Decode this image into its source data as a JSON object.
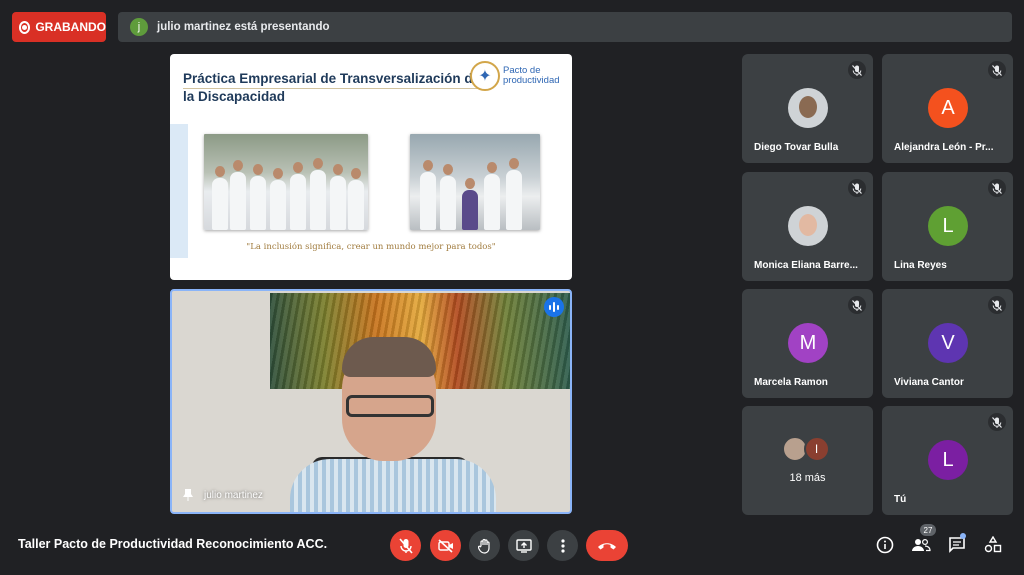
{
  "recording": {
    "label": "GRABANDO"
  },
  "presenting": {
    "avatar_letter": "j",
    "text": "julio martinez está presentando"
  },
  "slide": {
    "title": "Práctica Empresarial de Transversalización de la Discapacidad",
    "logo_text_1": "Pacto de",
    "logo_text_2": "productividad",
    "quote": "\"La inclusión significa, crear un mundo mejor para todos\""
  },
  "presenter": {
    "name": "julio martinez"
  },
  "participants": [
    {
      "name": "Diego Tovar Bulla",
      "avatar": "photo",
      "muted": true
    },
    {
      "name": "Alejandra León - Pr...",
      "avatar": "A",
      "color": "#f4511e",
      "muted": true
    },
    {
      "name": "Monica Eliana Barre...",
      "avatar": "photo",
      "muted": true
    },
    {
      "name": "Lina Reyes",
      "avatar": "L",
      "color": "#5fa033",
      "muted": true
    },
    {
      "name": "Marcela Ramon",
      "avatar": "M",
      "color": "#a142c4",
      "muted": true
    },
    {
      "name": "Viviana Cantor",
      "avatar": "V",
      "color": "#5e35b1",
      "muted": true
    },
    {
      "name": "Tú",
      "avatar": "L",
      "color": "#7b1fa2",
      "muted": true
    }
  ],
  "more": {
    "label": "18 más",
    "second_letter": "I"
  },
  "bottom": {
    "meeting_title": "Taller Pacto de Productividad Reconocimiento ACC...",
    "people_count": "27"
  },
  "colors": {
    "danger": "#ea4335",
    "accent": "#8ab4f8",
    "surface": "#3c4043",
    "background": "#202124"
  }
}
